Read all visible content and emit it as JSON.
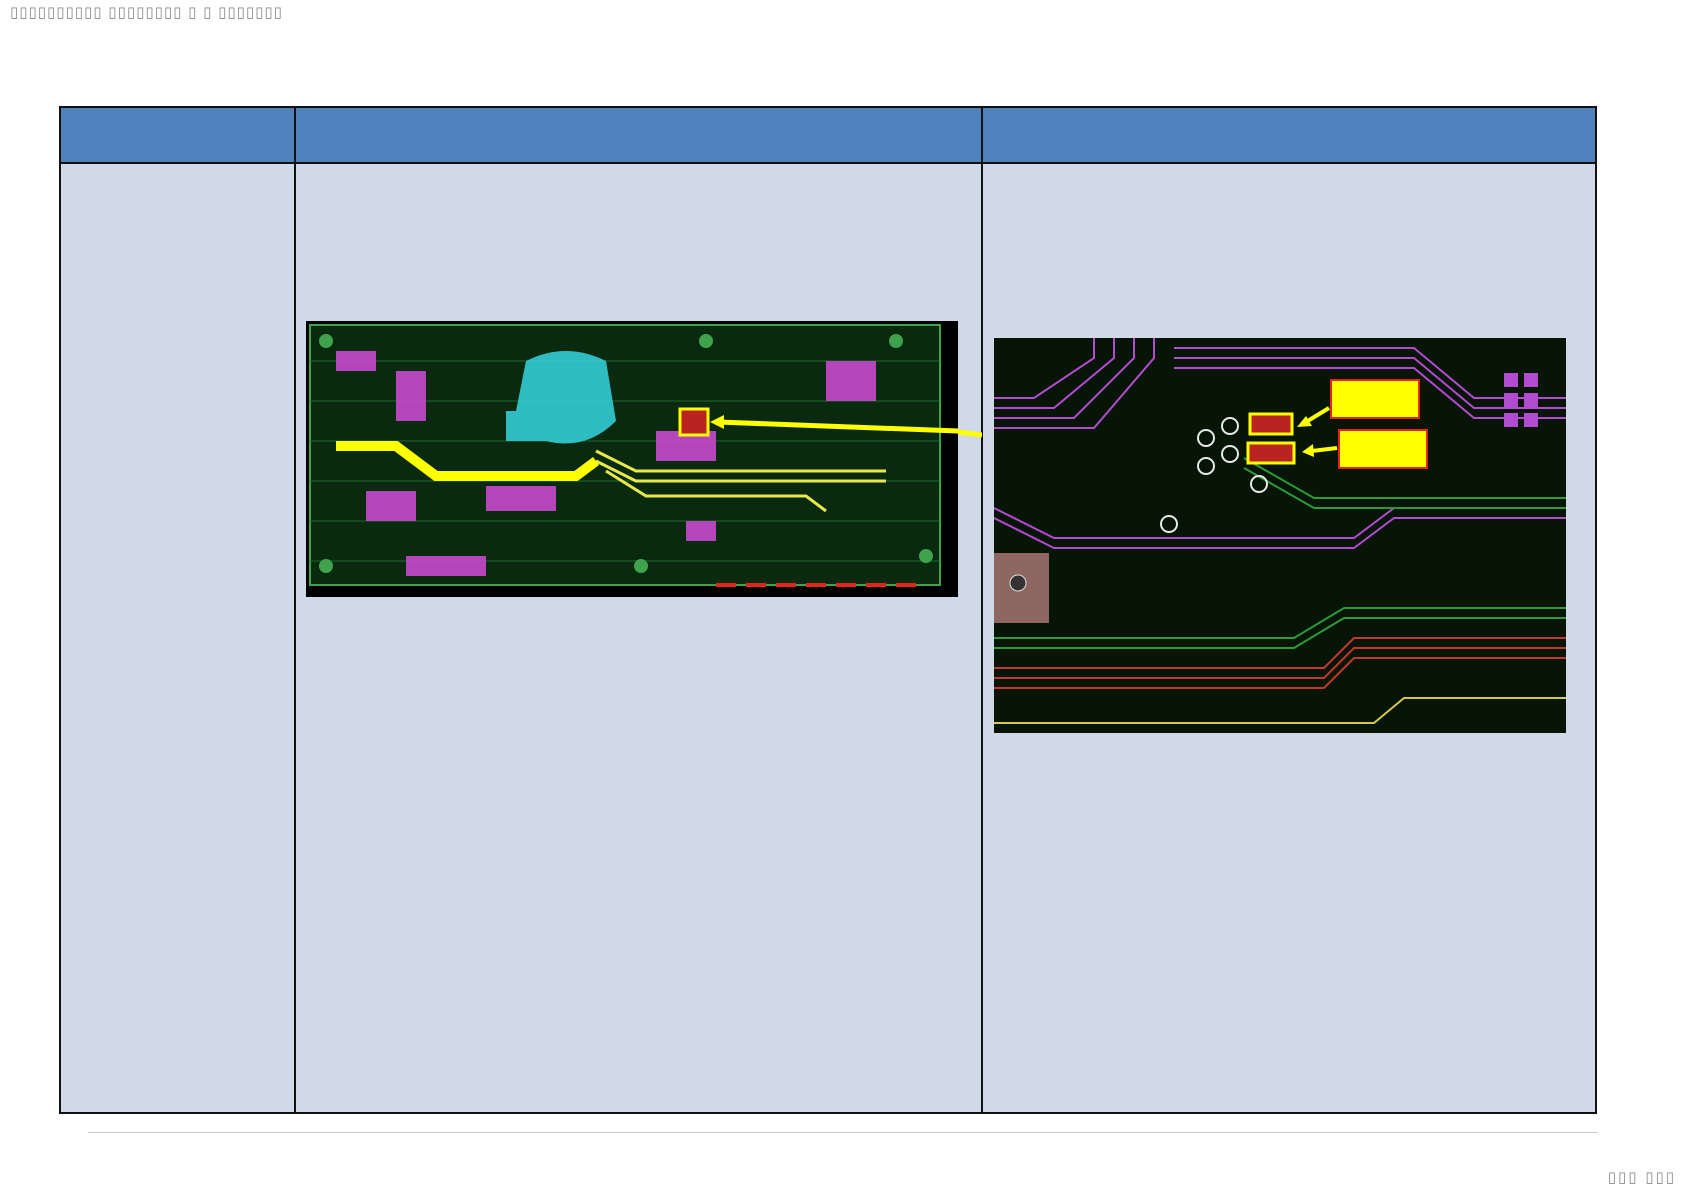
{
  "page": {
    "top_header_text": "▯▯▯▯▯▯▯▯▯▯ ▯▯▯▯▯▯▯▯ ▯ ▯ ▯▯▯▯▯▯▯",
    "page_number": "▯▯▯ ▯▯▯"
  },
  "table": {
    "columns": [
      "",
      "",
      ""
    ],
    "row": {
      "col1": "",
      "col2": "",
      "col3": ""
    }
  },
  "images": {
    "overview": {
      "description_icon": "pcb-layout-overview-image"
    },
    "zoom": {
      "description_icon": "pcb-layout-zoom-image"
    }
  },
  "colors": {
    "header_blue": "#4f81bd",
    "body_blue": "#cfd9e8",
    "highlight_yellow": "#ffff00",
    "highlight_red": "#e8231a"
  }
}
